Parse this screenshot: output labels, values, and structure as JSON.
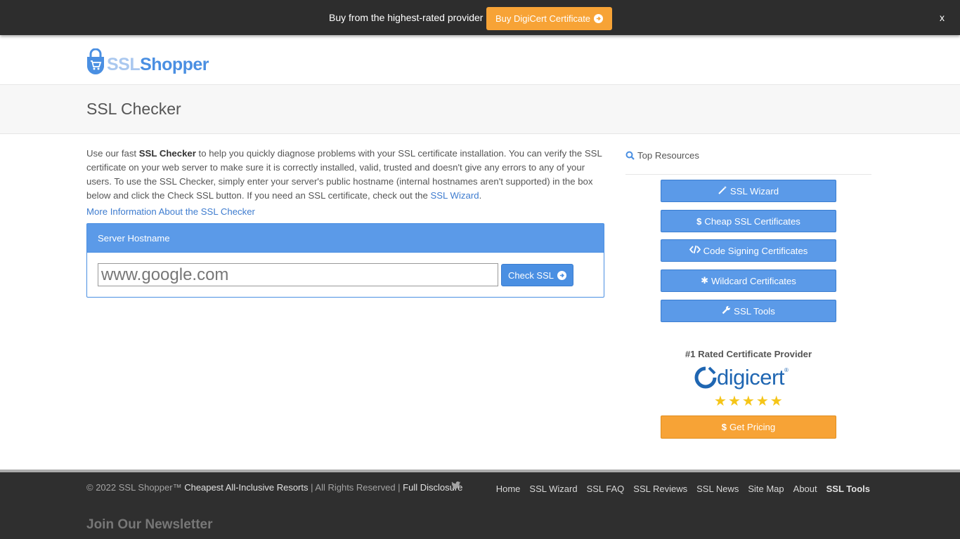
{
  "promo": {
    "text": "Buy from the highest-rated provider",
    "button_label": "Buy DigiCert Certificate",
    "close_label": "x"
  },
  "logo": {
    "part1": "SSL",
    "part2": "Shopper"
  },
  "page": {
    "title": "SSL Checker"
  },
  "intro": {
    "p1": "Use our fast ",
    "bold": "SSL Checker",
    "p2": " to help you quickly diagnose problems with your SSL certificate installation. You can verify the SSL certificate on your web server to make sure it is correctly installed, valid, trusted and doesn't give any errors to any of your users. To use the SSL Checker, simply enter your server's public hostname (internal hostnames aren't supported) in the box below and click the Check SSL button. If you need an SSL certificate, check out the ",
    "link": "SSL Wizard",
    "p3": ".",
    "more_info": "More Information About the SSL Checker"
  },
  "checker": {
    "panel_title": "Server Hostname",
    "placeholder": "www.google.com",
    "button_label": "Check SSL"
  },
  "sidebar": {
    "heading": "Top Resources",
    "buttons": [
      {
        "label": "SSL Wizard",
        "icon": "magic-wand-icon"
      },
      {
        "label": "Cheap SSL Certificates",
        "icon": "dollar-icon"
      },
      {
        "label": "Code Signing Certificates",
        "icon": "code-icon"
      },
      {
        "label": "Wildcard Certificates",
        "icon": "asterisk-icon"
      },
      {
        "label": "SSL Tools",
        "icon": "wrench-icon"
      }
    ],
    "rated_text": "#1 Rated Certificate Provider",
    "brand": "digicert",
    "stars": 5,
    "pricing_label": "Get Pricing"
  },
  "footer": {
    "copyright": "© 2022 SSL Shopper™",
    "resorts_link": "Cheapest All-Inclusive Resorts",
    "rights": " | All Rights Reserved | ",
    "disclosure": "Full Disclosure",
    "nav": [
      "Home",
      "SSL Wizard",
      "SSL FAQ",
      "SSL Reviews",
      "SSL News",
      "Site Map",
      "About",
      "SSL Tools"
    ],
    "newsletter": "Join Our Newsletter"
  },
  "colors": {
    "accent_blue": "#5b9ae8",
    "accent_orange": "#f7a336",
    "dark_bar": "#2d2d2d"
  }
}
